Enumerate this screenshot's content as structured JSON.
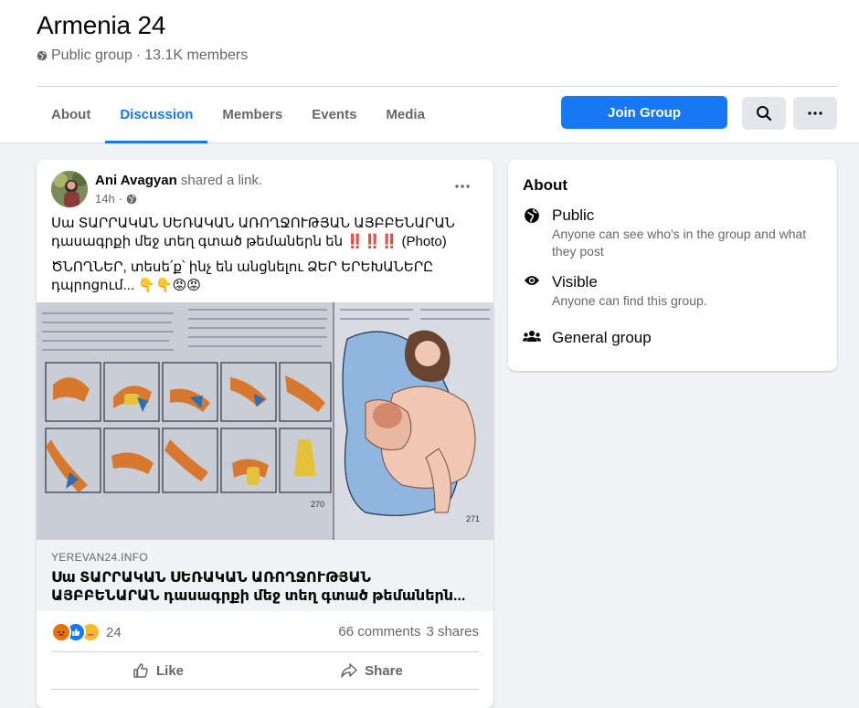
{
  "group": {
    "name": "Armenia 24",
    "privacy": "Public group",
    "members": "13.1K members",
    "separator": "·"
  },
  "tabs": [
    "About",
    "Discussion",
    "Members",
    "Events",
    "Media"
  ],
  "active_tab": "Discussion",
  "actions": {
    "join_label": "Join Group",
    "search_icon": "search-icon",
    "more_icon": "more-dots-icon"
  },
  "post": {
    "author": "Ani Avagyan",
    "action_text": "shared a link.",
    "time": "14h",
    "audience_icon": "globe-icon",
    "text_line1": "Սա ՏԱՐՐԱԿԱՆ ՍԵՌԱԿԱՆ ԱՌՈՂՋՈՒԹՅԱՆ ԱՅԲԲԵՆԱՐԱՆ դասագրքի մեջ տեղ գտած թեմաներն են ‼️‼️‼️ (Photo)",
    "text_line2": "ԾՆՈՂՆԵՐ, տեսե՛ք՝ ինչ են անցնելու ՁԵՐ ԵՐԵԽԱՆԵՐԸ դպրոցում... 👇👇😡😡",
    "link_domain": "YEREVAN24.INFO",
    "link_title": "Սա ՏԱՐՐԱԿԱՆ ՍԵՌԱԿԱՆ ԱՌՈՂՋՈՒԹՅԱՆ ԱՅԲԲԵՆԱՐԱՆ դասագրքի մեջ տեղ գտած թեմաներն...",
    "reaction_count": "24",
    "comments": "66 comments",
    "shares": "3 shares",
    "like_label": "Like",
    "share_label": "Share",
    "reaction_colors": {
      "angry": "#e9710f",
      "like": "#1877f2",
      "care": "#f7b928"
    }
  },
  "about": {
    "heading": "About",
    "items": [
      {
        "icon": "globe-icon",
        "title": "Public",
        "desc": "Anyone can see who's in the group and what they post"
      },
      {
        "icon": "eye-icon",
        "title": "Visible",
        "desc": "Anyone can find this group."
      },
      {
        "icon": "people-icon",
        "title": "General group",
        "desc": ""
      }
    ]
  },
  "colors": {
    "accent": "#1877f2",
    "secondary_text": "#65676b",
    "page_bg": "#f0f2f5"
  }
}
